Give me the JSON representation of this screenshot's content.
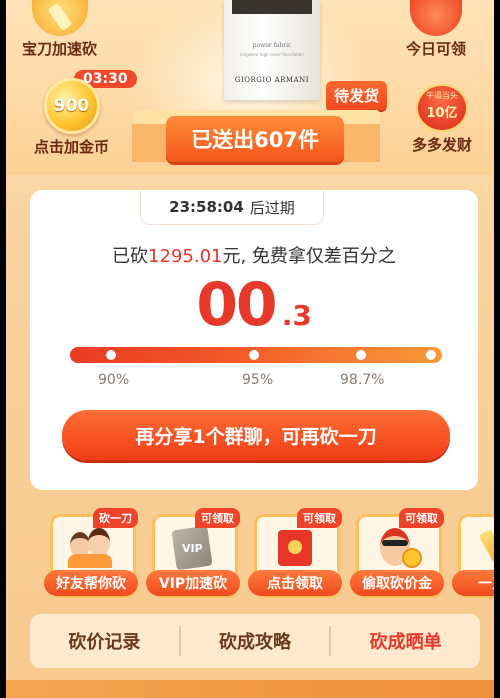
{
  "top": {
    "left_top_label": "宝刀加速砍",
    "timer": "03:30",
    "coin_value": "900",
    "coin_label": "点击加金币",
    "right_top_label": "今日可领",
    "right_bottom_badge": "10亿",
    "right_bottom_small": "牛逼当头",
    "right_bottom_label": "多多发财",
    "pending_label": "待发货",
    "sent_text": "已送出607件",
    "product": {
      "line1": "power fabric",
      "line2": "longwear high cover foundation",
      "brand": "GIORGIO ARMANI"
    }
  },
  "card": {
    "expire_time": "23:58:04",
    "expire_suffix": "后过期",
    "cut_prefix": "已砍",
    "cut_amount": "1295.01",
    "cut_suffix": "元, 免费拿仅差百分之",
    "percent_big": "00",
    "percent_small": ".3",
    "progress_ticks": [
      "90%",
      "95%",
      "98.7%"
    ],
    "share_button": "再分享1个群聊，可再砍一刀"
  },
  "tasks": [
    {
      "tag": "砍一刀",
      "label": "好友帮你砍",
      "icon": "friends-icon"
    },
    {
      "tag": "可领取",
      "label": "VIP加速砍",
      "icon": "vip-card-icon"
    },
    {
      "tag": "可领取",
      "label": "点击领取",
      "icon": "red-envelope-icon"
    },
    {
      "tag": "可领取",
      "label": "偷取砍价金",
      "icon": "thief-icon"
    },
    {
      "tag": "",
      "label": "一刀砍",
      "icon": "knife-icon"
    }
  ],
  "bottom_tabs": [
    "砍价记录",
    "砍成攻略",
    "砍成晒单"
  ],
  "colors": {
    "accent_red": "#e8382a",
    "orange": "#f5551a",
    "background": "#f9d4a0"
  }
}
